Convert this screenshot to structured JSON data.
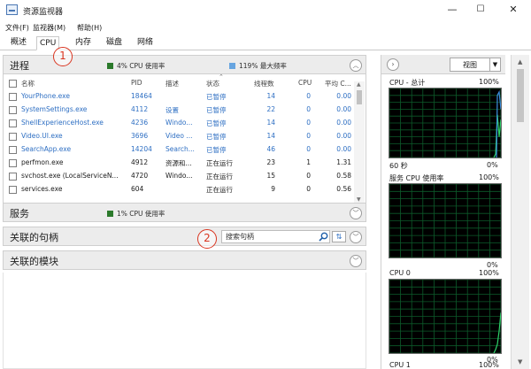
{
  "window": {
    "title": "资源监视器",
    "minimize": "—",
    "maximize": "☐",
    "close": "✕"
  },
  "menu": [
    "文件(F)",
    "监视器(M)",
    "帮助(H)"
  ],
  "tabs": [
    "概述",
    "CPU",
    "内存",
    "磁盘",
    "网络"
  ],
  "active_tab": "CPU",
  "markers": [
    "1",
    "2"
  ],
  "processes": {
    "title": "进程",
    "cpu_usage": "4% CPU 使用率",
    "max_freq": "119% 最大频率",
    "cpu_usage_color": "#2b7a2b",
    "max_freq_color": "#67a5e0",
    "columns": [
      "名称",
      "PID",
      "描述",
      "状态",
      "线程数",
      "CPU",
      "平均 C..."
    ],
    "rows": [
      {
        "name": "YourPhone.exe",
        "pid": "18464",
        "desc": "",
        "status": "已暂停",
        "threads": "14",
        "cpu": "0",
        "avg": "0.00",
        "suspended": true
      },
      {
        "name": "SystemSettings.exe",
        "pid": "4112",
        "desc": "设置",
        "status": "已暂停",
        "threads": "22",
        "cpu": "0",
        "avg": "0.00",
        "suspended": true
      },
      {
        "name": "ShellExperienceHost.exe",
        "pid": "4236",
        "desc": "Windo...",
        "status": "已暂停",
        "threads": "14",
        "cpu": "0",
        "avg": "0.00",
        "suspended": true
      },
      {
        "name": "Video.UI.exe",
        "pid": "3696",
        "desc": "Video ...",
        "status": "已暂停",
        "threads": "14",
        "cpu": "0",
        "avg": "0.00",
        "suspended": true
      },
      {
        "name": "SearchApp.exe",
        "pid": "14204",
        "desc": "Search...",
        "status": "已暂停",
        "threads": "46",
        "cpu": "0",
        "avg": "0.00",
        "suspended": true
      },
      {
        "name": "perfmon.exe",
        "pid": "4912",
        "desc": "资源和...",
        "status": "正在运行",
        "threads": "23",
        "cpu": "1",
        "avg": "1.31",
        "suspended": false
      },
      {
        "name": "svchost.exe (LocalServiceN...",
        "pid": "4720",
        "desc": "Windo...",
        "status": "正在运行",
        "threads": "15",
        "cpu": "0",
        "avg": "0.58",
        "suspended": false
      },
      {
        "name": "services.exe",
        "pid": "604",
        "desc": "",
        "status": "正在运行",
        "threads": "9",
        "cpu": "0",
        "avg": "0.56",
        "suspended": false
      }
    ]
  },
  "services": {
    "title": "服务",
    "cpu_usage": "1% CPU 使用率"
  },
  "handles": {
    "title": "关联的句柄",
    "search_placeholder": "搜索句柄"
  },
  "modules": {
    "title": "关联的模块"
  },
  "right_panel": {
    "view_label": "视图",
    "graphs": [
      {
        "title": "CPU - 总计",
        "max": "100%",
        "footer": "60 秒",
        "footer_right": "0%",
        "spike_level": 0.62
      },
      {
        "title": "服务 CPU 使用率",
        "max": "100%",
        "footer": "",
        "footer_right": "0%",
        "spike_level": 0
      },
      {
        "title": "CPU 0",
        "max": "100%",
        "footer": "",
        "footer_right": "0%",
        "spike_level": 0.12
      },
      {
        "title": "CPU 1",
        "max": "100%",
        "footer": "",
        "footer_right": "",
        "spike_level": 0
      }
    ]
  }
}
